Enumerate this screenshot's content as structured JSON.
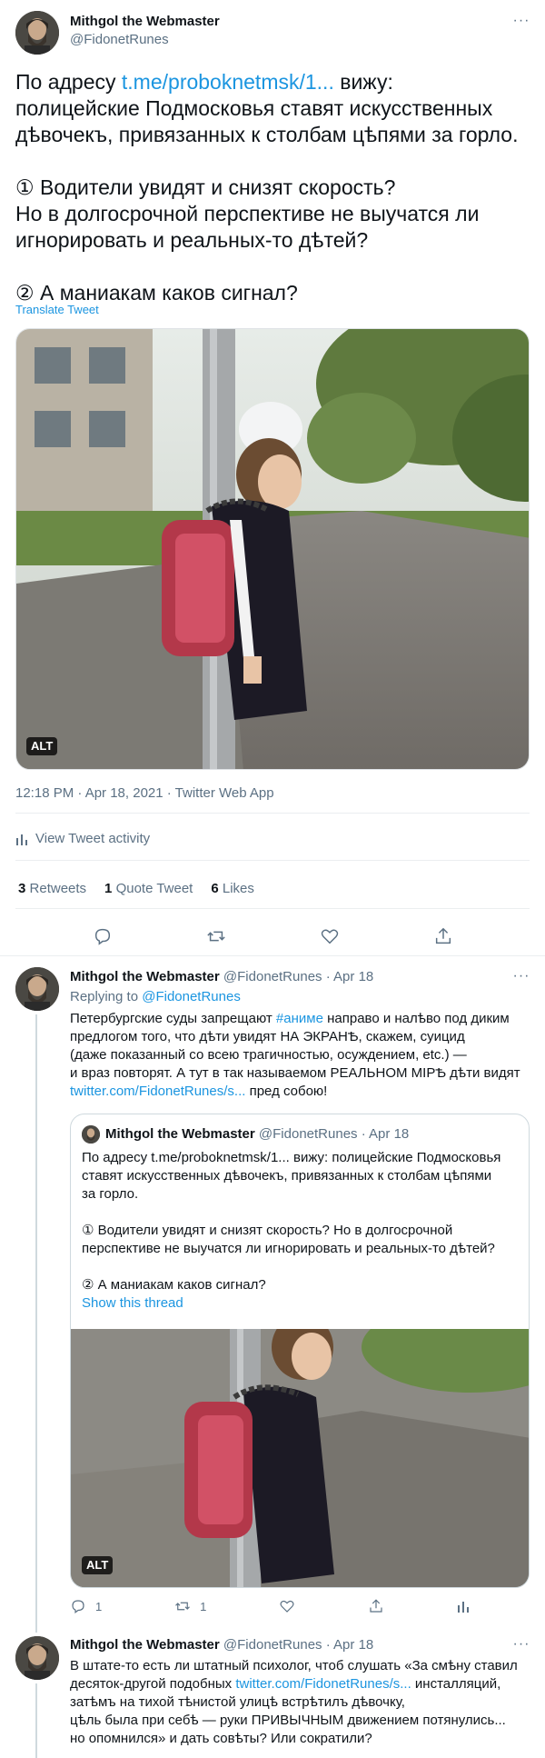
{
  "main_tweet": {
    "author_name": "Mithgol the Webmaster",
    "author_handle": "@FidonetRunes",
    "text_prefix": "По адресу ",
    "link": "t.me/proboknetmsk/1...",
    "text_line1_suffix": " вижу:",
    "text_line2": "полицейские Подмосковья ставят искусственных",
    "text_line3": "дѣвочекъ, привязанных к столбам цѣпями за горло.",
    "text_q1_line1": "① Водители увидят и снизят скорость?",
    "text_q1_line2": "Но в долгосрочной перспективе не выучатся ли",
    "text_q1_line3": "игнорировать и реальных-то дѣтей?",
    "text_q2": "② А маниакам каков сигнал?",
    "translate": "Translate Tweet",
    "alt": "ALT",
    "timestamp": "12:18 PM · Apr 18, 2021 · Twitter Web App",
    "activity": "View Tweet activity",
    "retweets_count": "3",
    "retweets_label": "Retweets",
    "quote_count": "1",
    "quote_label": "Quote Tweet",
    "likes_count": "6",
    "likes_label": "Likes"
  },
  "reply1": {
    "author_name": "Mithgol the Webmaster",
    "author_handle": "@FidonetRunes",
    "date": "· Apr 18",
    "replying_prefix": "Replying to ",
    "replying_to": "@FidonetRunes",
    "line1_a": "Петербургские суды запрещают ",
    "hashtag": "#аниме",
    "line1_b": " направо и налѣво под диким",
    "line2": "предлогом того, что дѣти увидят НА ЭКРАНѢ, скажем, суицид",
    "line3": "(даже показанный со всею трагичностью, осуждением, etc.) —",
    "line4": "и враз повторят. А тут в так называемом РЕАЛЬНОМ МІРѢ дѣти видят",
    "link": "twitter.com/FidonetRunes/s...",
    "line5_suffix": " пред собою!",
    "quote": {
      "author_name": "Mithgol the Webmaster",
      "author_handle": "@FidonetRunes",
      "date": "· Apr 18",
      "line1": "По адресу t.me/proboknetmsk/1... вижу: полицейские Подмосковья",
      "line2": "ставят искусственных дѣвочекъ, привязанных к столбам цѣпями",
      "line3": "за горло.",
      "line4": "① Водители увидят и снизят скорость? Но в долгосрочной",
      "line5": "перспективе не выучатся ли игнорировать и реальных-то дѣтей?",
      "line6": "② А маниакам каков сигнал?",
      "show_thread": "Show this thread",
      "alt": "ALT"
    },
    "reply_count": "1",
    "retweet_count": "1"
  },
  "reply2": {
    "author_name": "Mithgol the Webmaster",
    "author_handle": "@FidonetRunes",
    "date": "· Apr 18",
    "line1": "В штате-то есть ли штатный психолог, чтоб слушать «За смѣну ставил",
    "line2_a": "десяток-другой подобных ",
    "link": "twitter.com/FidonetRunes/s...",
    "line2_b": " инсталляций,",
    "line3": "затѣмъ на тихой тѣнистой улицѣ встрѣтилъ дѣвочку,",
    "line4": "цѣль была при себѣ — руки ПРИВЫЧНЫМ движением потянулись...",
    "line5": "но опомнился» и дать совѣты? Или сократили?"
  }
}
